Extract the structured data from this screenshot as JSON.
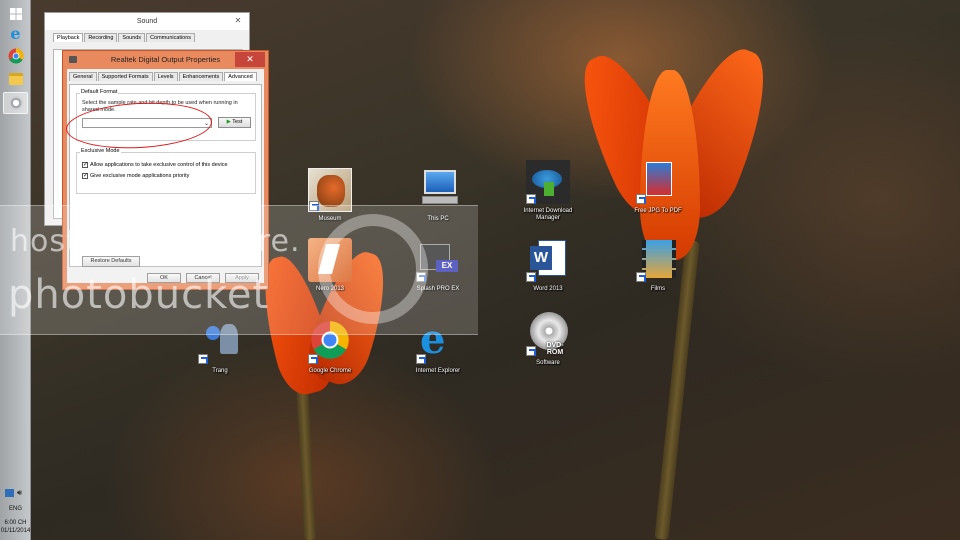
{
  "sound_window": {
    "title": "Sound",
    "close": "✕",
    "tabs": [
      "Playback",
      "Recording",
      "Sounds",
      "Communications"
    ]
  },
  "realtek_window": {
    "title": "Realtek Digital Output Properties",
    "close": "✕",
    "tabs": [
      "General",
      "Supported Formats",
      "Levels",
      "Enhancements",
      "Advanced"
    ],
    "default_format": {
      "group_title": "Default Format",
      "description": "Select the sample rate and bit depth to be used when running in shared mode.",
      "selected_value": "",
      "test_label": "Test"
    },
    "exclusive_mode": {
      "group_title": "Exclusive Mode",
      "options": [
        "Allow applications to take exclusive control of this device",
        "Give exclusive mode applications priority"
      ]
    },
    "restore_label": "Restore Defaults",
    "ok_label": "OK",
    "cancel_label": "Cancel",
    "apply_label": "Apply"
  },
  "desktop_icons": [
    {
      "label": "Museum",
      "icon": "museum-icon"
    },
    {
      "label": "This PC",
      "icon": "computer-icon"
    },
    {
      "label": "Internet Download Manager",
      "icon": "idm-icon"
    },
    {
      "label": "Free JPG To PDF",
      "icon": "jpg-pdf-icon"
    },
    {
      "label": "Nero 2013",
      "icon": "nero-icon"
    },
    {
      "label": "Splash PRO EX",
      "icon": "splash-icon"
    },
    {
      "label": "Word 2013",
      "icon": "word-icon"
    },
    {
      "label": "Films",
      "icon": "films-icon"
    },
    {
      "label": "Trang",
      "icon": "trang-icon"
    },
    {
      "label": "Google Chrome",
      "icon": "chrome-icon"
    },
    {
      "label": "Internet Explorer",
      "icon": "ie-icon"
    },
    {
      "label": "DVD-ROM",
      "icon": "dvd-icon"
    },
    {
      "label": "Software",
      "icon": "software-icon"
    }
  ],
  "taskbar": {
    "language": "ENG",
    "time": "6:00 CH",
    "date": "01/11/2014"
  },
  "watermark": {
    "line1": "host. store. share.",
    "line2": "photobucket"
  },
  "colors": {
    "accent_orange": "#e88a5e",
    "close_red": "#c7463b",
    "annotation_red": "#e01515"
  }
}
